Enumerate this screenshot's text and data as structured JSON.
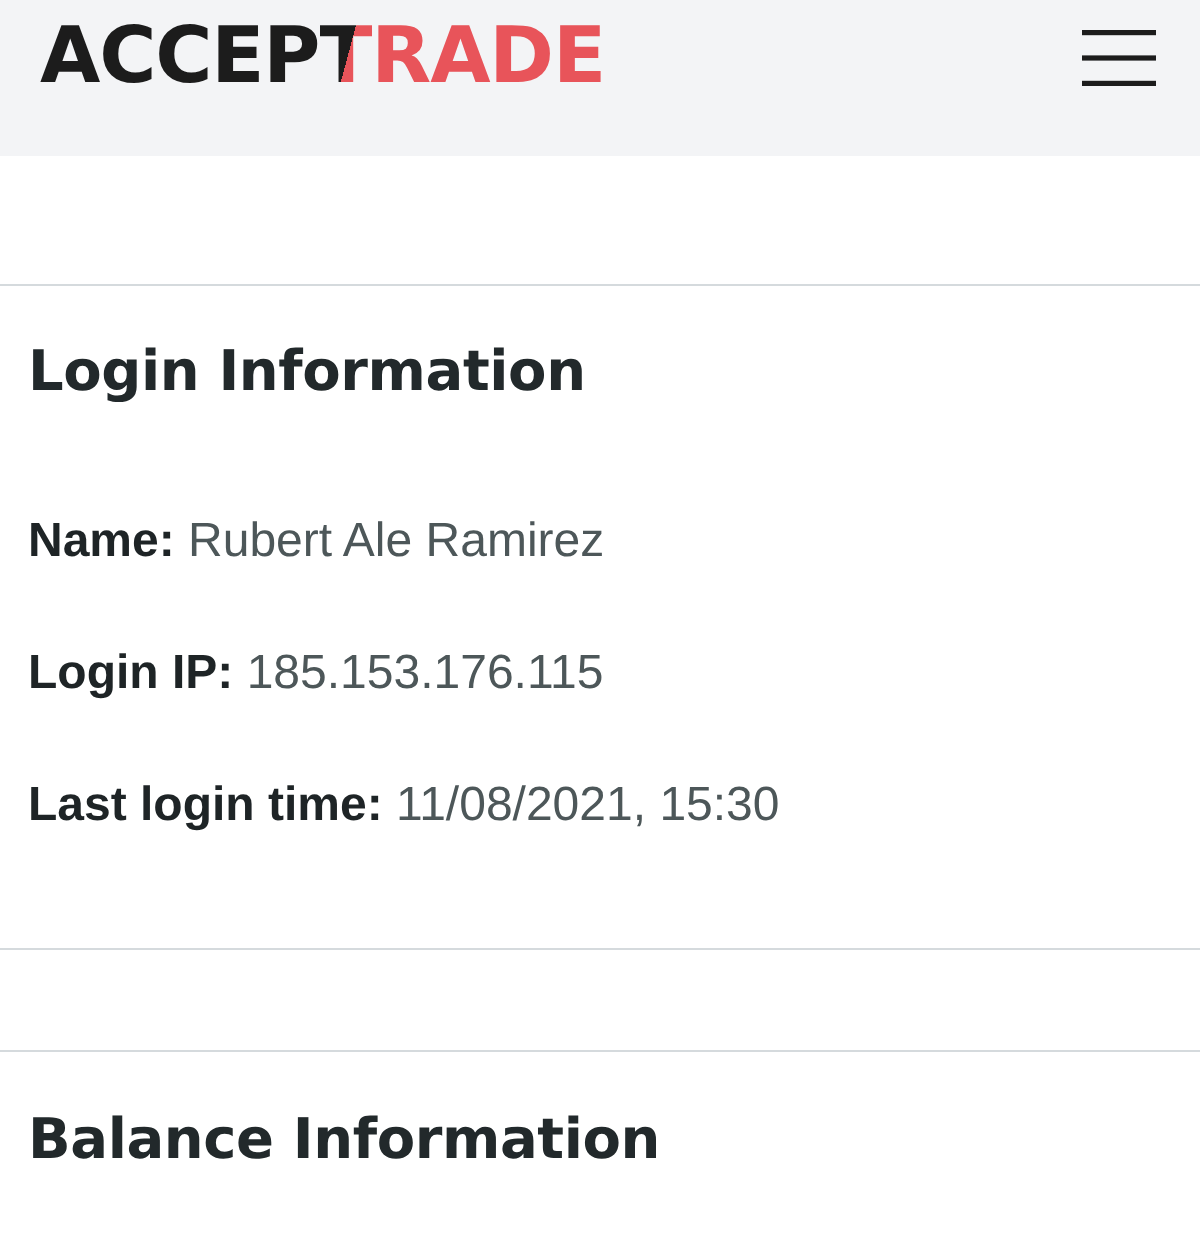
{
  "header": {
    "logo": {
      "text_dark": "ACCEP",
      "text_split": "T",
      "text_accent": "RADE"
    }
  },
  "login_information": {
    "title": "Login Information",
    "fields": [
      {
        "label": "Name:",
        "value": "Rubert Ale Ramirez"
      },
      {
        "label": "Login IP:",
        "value": "185.153.176.115"
      },
      {
        "label": "Last login time:",
        "value": "11/08/2021, 15:30"
      }
    ]
  },
  "balance_information": {
    "title": "Balance Information"
  }
}
